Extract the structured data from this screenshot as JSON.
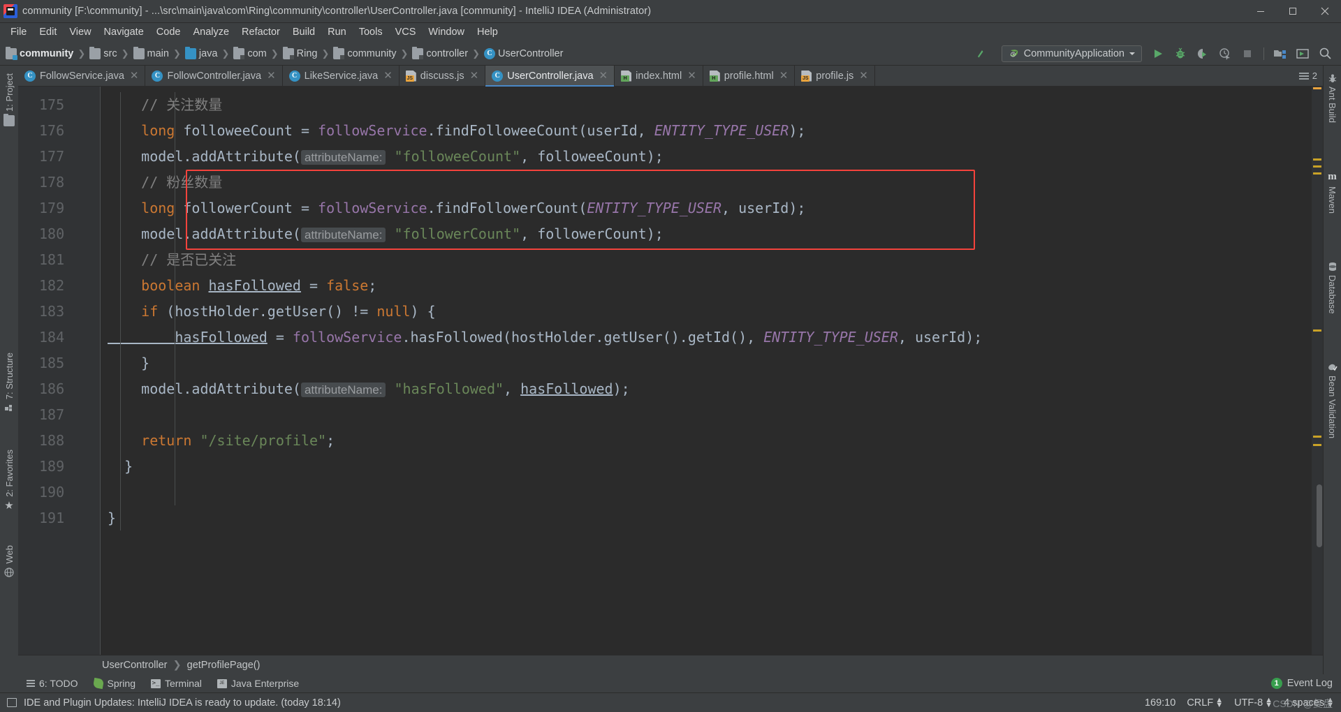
{
  "window": {
    "title": "community [F:\\community] - ...\\src\\main\\java\\com\\Ring\\community\\controller\\UserController.java [community] - IntelliJ IDEA (Administrator)",
    "app_icon": "intellij-idea-icon",
    "minimize": "minimize-icon",
    "maximize": "maximize-icon",
    "close": "close-icon"
  },
  "menu": [
    {
      "label": "File"
    },
    {
      "label": "Edit"
    },
    {
      "label": "View"
    },
    {
      "label": "Navigate"
    },
    {
      "label": "Code"
    },
    {
      "label": "Analyze"
    },
    {
      "label": "Refactor"
    },
    {
      "label": "Build"
    },
    {
      "label": "Run"
    },
    {
      "label": "Tools"
    },
    {
      "label": "VCS"
    },
    {
      "label": "Window"
    },
    {
      "label": "Help"
    }
  ],
  "breadcrumb": [
    {
      "label": "community",
      "icon": "project-folder-icon"
    },
    {
      "label": "src",
      "icon": "folder-icon"
    },
    {
      "label": "main",
      "icon": "folder-icon"
    },
    {
      "label": "java",
      "icon": "source-folder-icon"
    },
    {
      "label": "com",
      "icon": "package-icon"
    },
    {
      "label": "Ring",
      "icon": "package-icon"
    },
    {
      "label": "community",
      "icon": "package-icon"
    },
    {
      "label": "controller",
      "icon": "package-icon"
    },
    {
      "label": "UserController",
      "icon": "java-class-icon"
    }
  ],
  "toolbar": {
    "update_arrow": "update-arrow-icon",
    "run_config": "CommunityApplication",
    "run_config_dropdown": "chevron-down-icon",
    "buttons": [
      {
        "name": "run-button",
        "icon": "play-icon"
      },
      {
        "name": "debug-button",
        "icon": "bug-icon"
      },
      {
        "name": "run-with-coverage-button",
        "icon": "coverage-icon"
      },
      {
        "name": "profile-button",
        "icon": "profiler-icon"
      },
      {
        "name": "stop-button",
        "icon": "stop-icon"
      },
      {
        "name": "project-structure-button",
        "icon": "project-structure-icon"
      },
      {
        "name": "console-button",
        "icon": "console-icon"
      },
      {
        "name": "search-everywhere-button",
        "icon": "search-icon"
      }
    ]
  },
  "left_tool_strip": [
    {
      "label": "1: Project",
      "icon": "project-folder-icon"
    },
    {
      "label": "7: Structure",
      "icon": "structure-icon"
    },
    {
      "label": "2: Favorites",
      "icon": "star-icon"
    },
    {
      "label": "Web",
      "icon": "web-icon"
    }
  ],
  "right_tool_strip": [
    {
      "label": "Ant Build",
      "icon": "ant-icon"
    },
    {
      "label": "Maven",
      "icon": "maven-m-icon"
    },
    {
      "label": "Database",
      "icon": "database-icon"
    },
    {
      "label": "Bean Validation",
      "icon": "bean-validation-icon"
    }
  ],
  "editor_tabs": {
    "tabs": [
      {
        "label": "FollowService.java",
        "type": "java",
        "active": false
      },
      {
        "label": "FollowController.java",
        "type": "java",
        "active": false
      },
      {
        "label": "LikeService.java",
        "type": "java",
        "active": false
      },
      {
        "label": "discuss.js",
        "type": "js",
        "active": false
      },
      {
        "label": "UserController.java",
        "type": "java",
        "active": true
      },
      {
        "label": "index.html",
        "type": "html",
        "active": false
      },
      {
        "label": "profile.html",
        "type": "html",
        "active": false
      },
      {
        "label": "profile.js",
        "type": "js",
        "active": false
      }
    ],
    "close_icon": "close-icon",
    "overflow_count": "2",
    "overflow_icon": "tab-list-icon"
  },
  "editor": {
    "first_line_number": 175,
    "lines": [
      {
        "num": "175",
        "fold": "none",
        "tokens": [
          {
            "t": "// 关注数量",
            "c": "tok-comment",
            "indent": 4
          }
        ]
      },
      {
        "num": "176",
        "fold": "none",
        "tokens": [
          {
            "t": "long ",
            "c": "tok-kw",
            "indent": 4
          },
          {
            "t": "followeeCount ",
            "c": "tok-plain"
          },
          {
            "t": "= ",
            "c": "tok-plain"
          },
          {
            "t": "followService",
            "c": "tok-field"
          },
          {
            "t": ".findFolloweeCount(userId, ",
            "c": "tok-plain"
          },
          {
            "t": "ENTITY_TYPE_USER",
            "c": "tok-static"
          },
          {
            "t": ");",
            "c": "tok-plain"
          }
        ]
      },
      {
        "num": "177",
        "fold": "none",
        "tokens": [
          {
            "t": "model",
            "c": "tok-plain",
            "indent": 4
          },
          {
            "t": ".addAttribute(",
            "c": "tok-plain"
          },
          {
            "t": "attributeName:",
            "c": "hint"
          },
          {
            "t": " \"followeeCount\"",
            "c": "tok-str"
          },
          {
            "t": ", followeeCount);",
            "c": "tok-plain"
          }
        ]
      },
      {
        "num": "178",
        "fold": "none",
        "tokens": [
          {
            "t": "// 粉丝数量",
            "c": "tok-comment",
            "indent": 4
          }
        ]
      },
      {
        "num": "179",
        "fold": "none",
        "tokens": [
          {
            "t": "long ",
            "c": "tok-kw",
            "indent": 4
          },
          {
            "t": "followerCount ",
            "c": "tok-plain"
          },
          {
            "t": "= ",
            "c": "tok-plain"
          },
          {
            "t": "followService",
            "c": "tok-field"
          },
          {
            "t": ".findFollowerCount(",
            "c": "tok-plain"
          },
          {
            "t": "ENTITY_TYPE_USER",
            "c": "tok-static"
          },
          {
            "t": ", userId);",
            "c": "tok-plain"
          }
        ]
      },
      {
        "num": "180",
        "fold": "none",
        "tokens": [
          {
            "t": "model",
            "c": "tok-plain",
            "indent": 4
          },
          {
            "t": ".addAttribute(",
            "c": "tok-plain"
          },
          {
            "t": "attributeName:",
            "c": "hint"
          },
          {
            "t": " \"followerCount\"",
            "c": "tok-str"
          },
          {
            "t": ", followerCount);",
            "c": "tok-plain"
          }
        ]
      },
      {
        "num": "181",
        "fold": "none",
        "tokens": [
          {
            "t": "// 是否已关注",
            "c": "tok-comment",
            "indent": 4
          }
        ]
      },
      {
        "num": "182",
        "fold": "none",
        "tokens": [
          {
            "t": "boolean ",
            "c": "tok-kw",
            "indent": 4
          },
          {
            "t": "hasFollowed",
            "c": "tok-plain tok-underline"
          },
          {
            "t": " = ",
            "c": "tok-plain"
          },
          {
            "t": "false",
            "c": "tok-kw"
          },
          {
            "t": ";",
            "c": "tok-plain"
          }
        ]
      },
      {
        "num": "183",
        "fold": "top",
        "tokens": [
          {
            "t": "if ",
            "c": "tok-kw",
            "indent": 4
          },
          {
            "t": "(hostHolder",
            "c": "tok-plain"
          },
          {
            "t": ".getUser() != ",
            "c": "tok-plain"
          },
          {
            "t": "null",
            "c": "tok-kw"
          },
          {
            "t": ") {",
            "c": "tok-plain"
          }
        ]
      },
      {
        "num": "184",
        "fold": "none",
        "tokens": [
          {
            "t": "hasFollowed",
            "c": "tok-plain tok-underline",
            "indent": 8
          },
          {
            "t": " = ",
            "c": "tok-plain"
          },
          {
            "t": "followService",
            "c": "tok-field"
          },
          {
            "t": ".hasFollowed(hostHolder.getUser().getId(), ",
            "c": "tok-plain"
          },
          {
            "t": "ENTITY_TYPE_USER",
            "c": "tok-static"
          },
          {
            "t": ", userId);",
            "c": "tok-plain"
          }
        ]
      },
      {
        "num": "185",
        "fold": "bottom",
        "tokens": [
          {
            "t": "}",
            "c": "tok-plain",
            "indent": 4
          }
        ]
      },
      {
        "num": "186",
        "fold": "none",
        "tokens": [
          {
            "t": "model",
            "c": "tok-plain",
            "indent": 4
          },
          {
            "t": ".addAttribute(",
            "c": "tok-plain"
          },
          {
            "t": "attributeName:",
            "c": "hint"
          },
          {
            "t": " \"hasFollowed\"",
            "c": "tok-str"
          },
          {
            "t": ", ",
            "c": "tok-plain"
          },
          {
            "t": "hasFollowed",
            "c": "tok-plain tok-underline"
          },
          {
            "t": ");",
            "c": "tok-plain"
          }
        ]
      },
      {
        "num": "187",
        "fold": "none",
        "tokens": []
      },
      {
        "num": "188",
        "fold": "none",
        "tokens": [
          {
            "t": "return ",
            "c": "tok-kw",
            "indent": 4
          },
          {
            "t": "\"/site/profile\"",
            "c": "tok-str"
          },
          {
            "t": ";",
            "c": "tok-plain"
          }
        ]
      },
      {
        "num": "189",
        "fold": "bottom",
        "tokens": [
          {
            "t": "}",
            "c": "tok-plain",
            "indent": 2
          }
        ]
      },
      {
        "num": "190",
        "fold": "none",
        "tokens": []
      },
      {
        "num": "191",
        "fold": "none",
        "tokens": [
          {
            "t": "}",
            "c": "tok-plain",
            "indent": 0
          }
        ]
      }
    ],
    "highlight_box": {
      "from_line": "178",
      "to_line": "180",
      "color": "#f4433c"
    }
  },
  "editor_breadcrumb": [
    {
      "label": "UserController"
    },
    {
      "label": "getProfilePage()"
    }
  ],
  "bottom_tools": [
    {
      "label": "6: TODO",
      "underline": "6",
      "icon": "todo-icon"
    },
    {
      "label": "Spring",
      "icon": "spring-leaf-icon"
    },
    {
      "label": "Terminal",
      "icon": "terminal-icon"
    },
    {
      "label": "Java Enterprise",
      "icon": "java-enterprise-icon"
    }
  ],
  "event_log": {
    "count": "1",
    "label": "Event Log"
  },
  "status": {
    "message": "IDE and Plugin Updates: IntelliJ IDEA is ready to update. (today 18:14)",
    "message_icon": "notification-icon",
    "caret": "169:10",
    "line_separator": "CRLF",
    "encoding": "UTF-8",
    "indent": "4 spaces",
    "watermark": "CSDN @复盘"
  },
  "colors": {
    "accent_blue": "#4a88c7",
    "green": "#59a869",
    "editor_bg": "#2b2b2b",
    "chrome_bg": "#3c3f41",
    "gutter_bg": "#313335",
    "highlight_red": "#f4433c"
  }
}
